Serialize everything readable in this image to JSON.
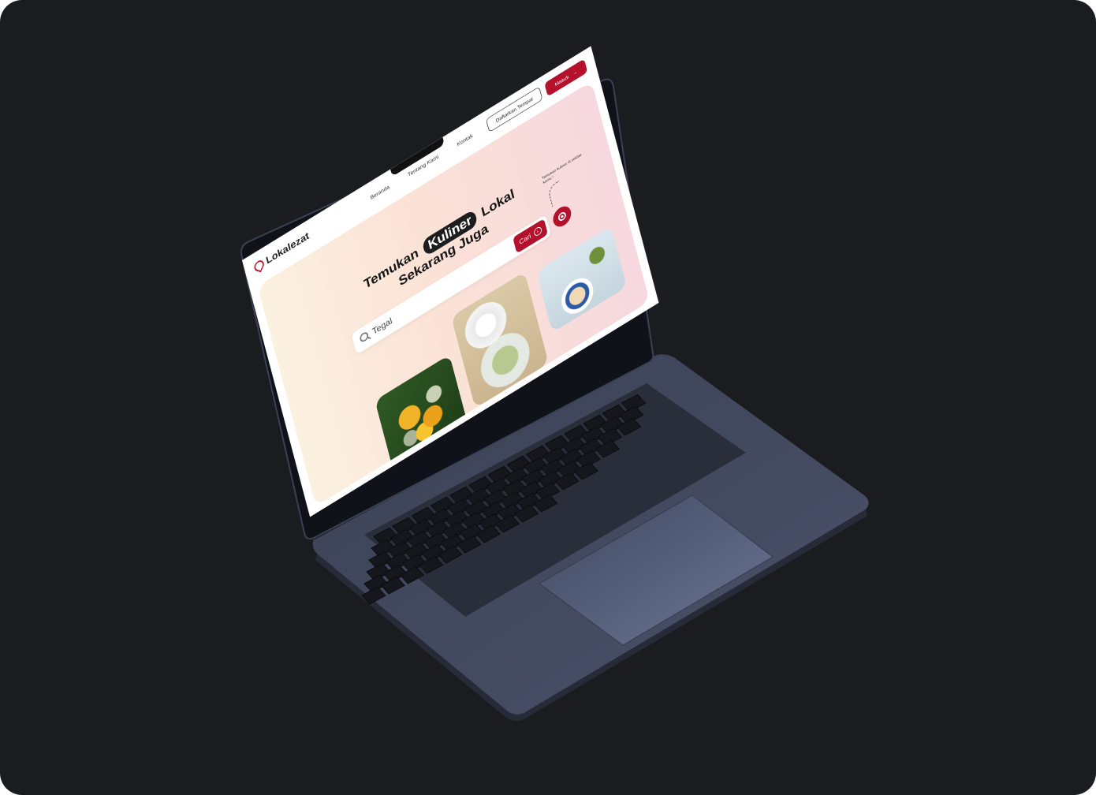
{
  "nav": {
    "brand": "Lokalezat",
    "menu": [
      "Beranda",
      "Tentang Kami",
      "Kontak"
    ],
    "register_place": "Daftarkan Tempat",
    "login": "Masuk"
  },
  "hero": {
    "headline_before": "Temukan",
    "headline_pill": "Kuliner",
    "headline_after": "Lokal",
    "headline_line2": "Sekarang Juga",
    "hint": "Temukan kuliner di sekitar kamu !",
    "search": {
      "value": "Tegal",
      "button": "Cari"
    }
  },
  "icons": [
    "location-pin-icon",
    "search-icon",
    "arrow-right-icon",
    "login-icon",
    "locate-icon"
  ],
  "colors": {
    "background": "#1b1c20",
    "accent": "#b3112c",
    "laptop_body": "#3c4256"
  }
}
